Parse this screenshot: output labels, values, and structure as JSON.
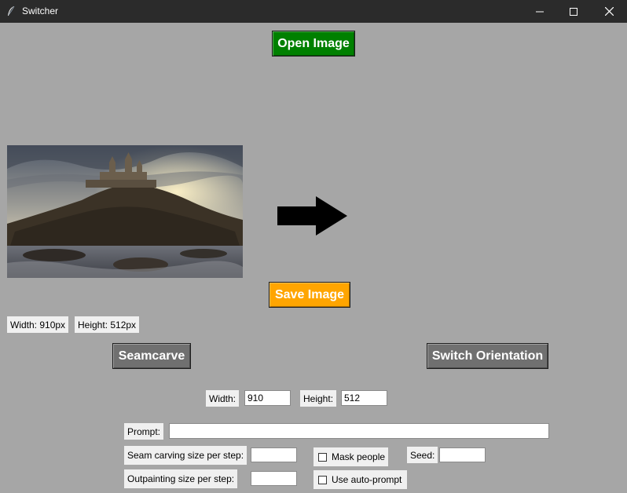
{
  "window": {
    "title": "Switcher",
    "icon": "feather-icon",
    "controls": [
      "minimize-icon",
      "maximize-icon",
      "close-icon"
    ]
  },
  "buttons": {
    "open_image": "Open Image",
    "save_image": "Save Image",
    "seamcarve": "Seamcarve",
    "switch_orientation": "Switch Orientation"
  },
  "colors": {
    "open_image": "#008000",
    "save_image": "#ffa500",
    "seamcarve": "#707070",
    "switch_orientation": "#707070",
    "background": "#a6a6a6"
  },
  "image_info": {
    "width_label": "Width: 910px",
    "height_label": "Height: 512px"
  },
  "dimensions": {
    "width_label": "Width:",
    "width_value": "910",
    "height_label": "Height:",
    "height_value": "512"
  },
  "prompt": {
    "label": "Prompt:",
    "value": ""
  },
  "options": {
    "seam_step_label": "Seam carving size per step:",
    "seam_step_value": "",
    "outpaint_step_label": "Outpainting size per step:",
    "outpaint_step_value": "",
    "mask_people_label": "Mask people",
    "mask_people_checked": false,
    "auto_prompt_label": "Use auto-prompt",
    "auto_prompt_checked": false,
    "seed_label": "Seed:",
    "seed_value": ""
  }
}
